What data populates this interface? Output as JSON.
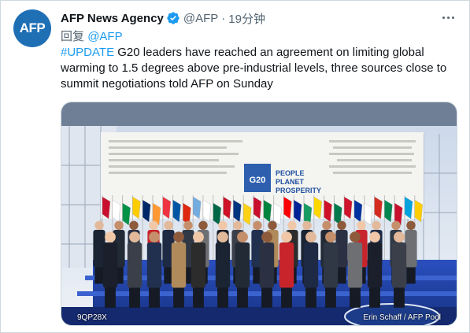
{
  "author": {
    "name": "AFP News Agency",
    "handle": "@AFP",
    "separator": "·",
    "time": "19分钟",
    "avatar_text": "AFP",
    "verified_icon": "verified-badge-icon"
  },
  "reply": {
    "prefix": "回复",
    "mention": "@AFP"
  },
  "tweet": {
    "hashtag": "#UPDATE",
    "body": " G20 leaders have reached an agreement on limiting global warming to 1.5 degrees above pre-industrial levels, three sources close to summit negotiations told AFP on Sunday"
  },
  "media": {
    "caption_left": "9QP28X",
    "caption_right": "Erin Schaff / AFP Pool",
    "banner_logo": "G20",
    "banner_lines": [
      "PEOPLE",
      "PLANET",
      "PROSPERITY"
    ]
  },
  "colors": {
    "link": "#1d9bf0",
    "secondary": "#536471",
    "avatar_bg": "#1f6fb5",
    "stage_blue": "#1d3f9e"
  }
}
